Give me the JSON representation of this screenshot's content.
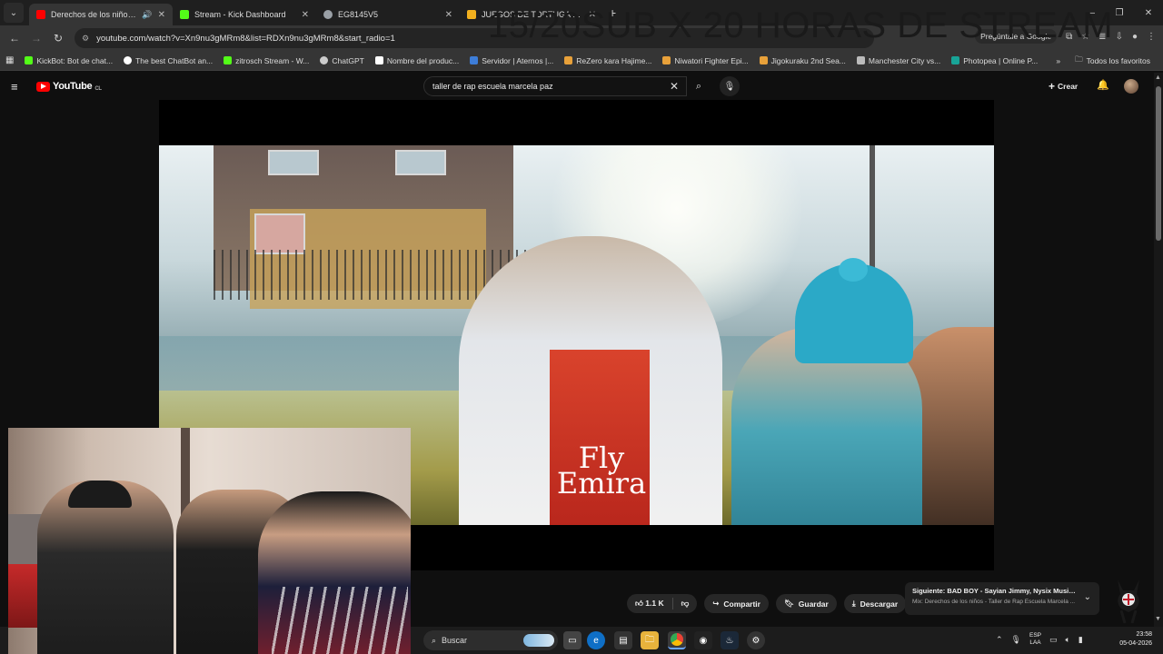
{
  "overlay_title": "15/20SUB X  20 HORAS DE STREAM",
  "browser": {
    "tabs": [
      {
        "title": "Derechos de los niños - Tall",
        "active": true,
        "favicon_color": "#ff0000",
        "has_audio": true
      },
      {
        "title": "Stream - Kick Dashboard",
        "active": false,
        "favicon_color": "#53fc18"
      },
      {
        "title": "EG8145V5",
        "active": false,
        "favicon_color": "#9aa0a6"
      },
      {
        "title": "JUEGOS DE TORTUGA GRATIS",
        "active": false,
        "favicon_color": "#f2b01e"
      }
    ],
    "url": "youtube.com/watch?v=Xn9nu3gMRm8&list=RDXn9nu3gMRm8&start_radio=1",
    "ask_google": "Pregúntale a Google",
    "bookmarks": [
      {
        "label": "KickBot: Bot de chat...",
        "color": "#53fc18"
      },
      {
        "label": "The best ChatBot an...",
        "color": "#ffffff"
      },
      {
        "label": "zitrosch Stream - W...",
        "color": "#53fc18"
      },
      {
        "label": "ChatGPT",
        "color": "#cccccc"
      },
      {
        "label": "Nombre del produc...",
        "color": "#ffffff"
      },
      {
        "label": "Servidor | Aternos |...",
        "color": "#3d7dd8"
      },
      {
        "label": "ReZero kara Hajime...",
        "color": "#e8a13a"
      },
      {
        "label": "Niwatori Fighter Epi...",
        "color": "#e8a13a"
      },
      {
        "label": "Jigokuraku 2nd Sea...",
        "color": "#e8a13a"
      },
      {
        "label": "Manchester City vs...",
        "color": "#bbbbbb"
      },
      {
        "label": "Photopea | Online P...",
        "color": "#18a497"
      }
    ],
    "all_bookmarks": "Todos los favoritos"
  },
  "youtube": {
    "logo": "YouTube",
    "region": "CL",
    "search_value": "taller de rap escuela marcela paz",
    "create_label": "Crear",
    "video": {
      "shirt_text": "Fly Emira"
    },
    "actions": {
      "likes": "1.1 K",
      "share": "Compartir",
      "save": "Guardar",
      "download": "Descargar"
    },
    "next": {
      "title": "Siguiente: BAD BOY - Sayian Jimmy, Nysix Music, G...",
      "subtitle": "Mix: Derechos de los niños - Taller de Rap Escuela Marcela ..."
    }
  },
  "taskbar": {
    "search_placeholder": "Buscar",
    "lang_top": "ESP",
    "lang_bottom": "LAA",
    "time": "23:58",
    "date": "05-04-2026"
  }
}
